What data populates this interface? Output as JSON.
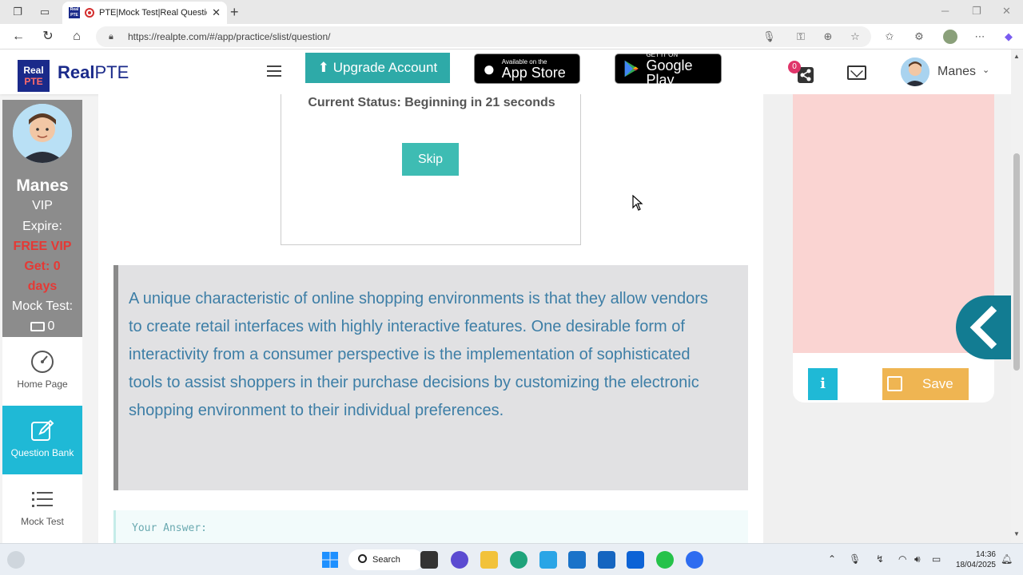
{
  "browser": {
    "tab_title": "PTE|Mock Test|Real Question",
    "url": "https://realpte.com/#/app/practice/slist/question/"
  },
  "header": {
    "logo_box_line1": "Real",
    "logo_box_line2": "PTE",
    "logo_text_bold": "Real",
    "logo_text_light": "PTE",
    "upgrade_label": "Upgrade Account",
    "appstore_small": "Available on the",
    "appstore_big": "App Store",
    "googleplay_small": "GET IT ON",
    "googleplay_big": "Google Play",
    "share_badge": "0",
    "user_name": "Manes"
  },
  "sidebar": {
    "name": "Manes",
    "membership": "VIP",
    "expire_label": "Expire:",
    "expire_value": "FREE VIP",
    "get_label": "Get:  0",
    "get_unit": "days",
    "mock_label": "Mock Test:",
    "mock_value": "0",
    "nav": [
      {
        "label": "Home Page"
      },
      {
        "label": "Question Bank"
      },
      {
        "label": "Mock Test"
      }
    ]
  },
  "main": {
    "status": "Current Status: Beginning in 21 seconds",
    "skip_label": "Skip",
    "passage": "A unique characteristic of online shopping environments is that they allow vendors to create retail interfaces with highly interactive features. One desirable form of interactivity from a consumer perspective is the implementation of sophisticated tools to assist shoppers in their purchase decisions by customizing the electronic shopping environment to their individual preferences.",
    "answer_label": "Your Answer:"
  },
  "right_panel": {
    "info_label": "i",
    "save_label": "Save"
  },
  "taskbar": {
    "search_label": "Search",
    "time": "14:36",
    "date": "18/04/2025"
  },
  "colors": {
    "teal": "#2eaaa8",
    "sidebar_active": "#1fb9d6",
    "passage_text": "#3d7ea6",
    "save": "#efb552",
    "pink": "#fad4d2"
  }
}
